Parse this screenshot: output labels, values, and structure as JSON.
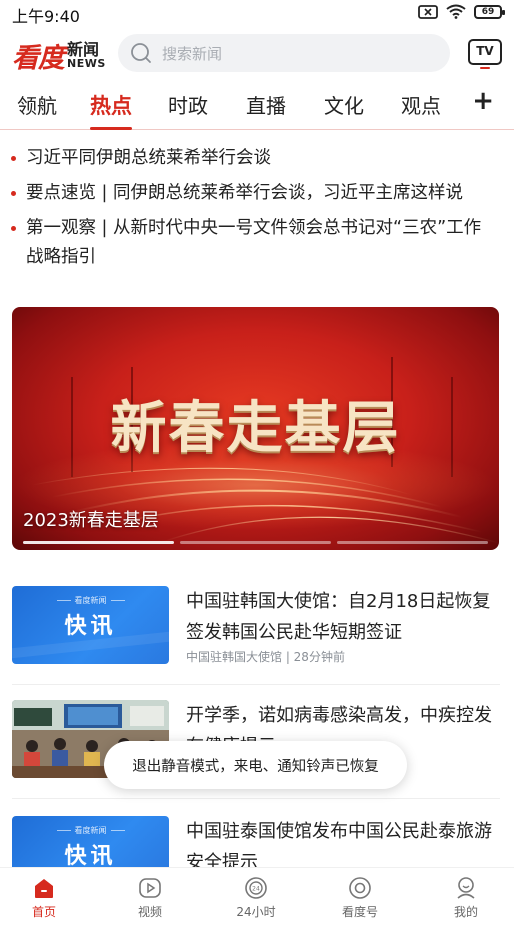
{
  "status_bar": {
    "time": "上午9:40",
    "battery": "69"
  },
  "header": {
    "logo_main": "看度",
    "logo_cn": "新闻",
    "logo_en": "NEWS",
    "search_placeholder": "搜索新闻",
    "tv_label": "TV"
  },
  "tabs": [
    {
      "label": "领航"
    },
    {
      "label": "热点",
      "active": true
    },
    {
      "label": "时政"
    },
    {
      "label": "直播"
    },
    {
      "label": "文化"
    },
    {
      "label": "观点"
    }
  ],
  "tab_add": "+",
  "headlines": [
    "习近平同伊朗总统莱希举行会谈",
    "要点速览 | 同伊朗总统莱希举行会谈，习近平主席这样说",
    "第一观察 | 从新时代中央一号文件领会总书记对“三农”工作战略指引"
  ],
  "banner": {
    "big_text": "新春走基层",
    "caption": "2023新春走基层"
  },
  "news": [
    {
      "thumb_small": "看度新闻",
      "thumb_main": "快讯",
      "title": "中国驻韩国大使馆：自2月18日起恢复签发韩国公民赴华短期签证",
      "meta": "中国驻韩国大使馆 | 28分钟前"
    },
    {
      "title": "开学季，诺如病毒感染高发，中疾控发布健康提示"
    },
    {
      "thumb_small": "看度新闻",
      "thumb_main": "快讯",
      "title": "中国驻泰国使馆发布中国公民赴泰旅游安全提示"
    }
  ],
  "toast": "退出静音模式，来电、通知铃声已恢复",
  "bottom_nav": [
    {
      "label": "首页",
      "icon": "home-icon",
      "active": true
    },
    {
      "label": "视频",
      "icon": "video-icon"
    },
    {
      "label": "24小时",
      "icon": "clock-24-icon"
    },
    {
      "label": "看度号",
      "icon": "account-icon"
    },
    {
      "label": "我的",
      "icon": "profile-icon"
    }
  ],
  "colors": {
    "accent": "#d62a1e",
    "kx_blue": "#2a79e0"
  }
}
